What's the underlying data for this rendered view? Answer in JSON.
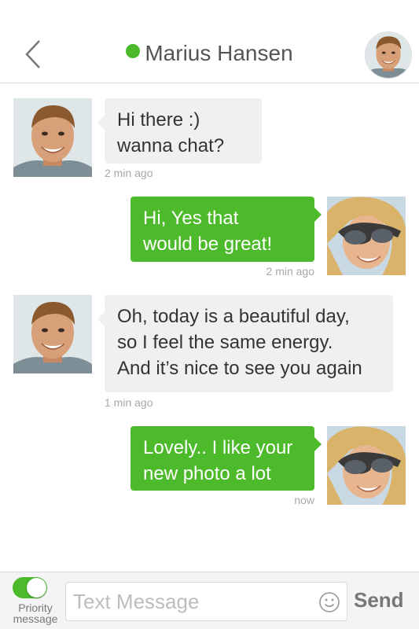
{
  "header": {
    "title": "Marius Hansen",
    "status": "online",
    "status_color": "#4cba2a"
  },
  "messages": [
    {
      "direction": "incoming",
      "avatar": "male-avatar",
      "lines": [
        "Hi there :)",
        "wanna chat?"
      ],
      "time": "2 min ago"
    },
    {
      "direction": "outgoing",
      "avatar": "female-avatar",
      "lines": [
        "Hi, Yes that",
        "would be great!"
      ],
      "time": "2 min ago"
    },
    {
      "direction": "incoming",
      "avatar": "male-avatar",
      "lines": [
        "Oh, today is a beautiful day,",
        "so I feel the same energy.",
        "And it’s nice to see you again"
      ],
      "time": "1 min ago"
    },
    {
      "direction": "outgoing",
      "avatar": "female-avatar",
      "lines": [
        "Lovely.. I like your",
        "new photo a lot"
      ],
      "time": "now"
    }
  ],
  "composer": {
    "priority_label_line1": "Priority",
    "priority_label_line2": "message",
    "priority_enabled": true,
    "placeholder": "Text Message",
    "value": "",
    "send_label": "Send"
  },
  "colors": {
    "accent": "#4cba2a",
    "incoming_bubble": "#f0f0f2",
    "timestamp": "#a8a8a8"
  }
}
